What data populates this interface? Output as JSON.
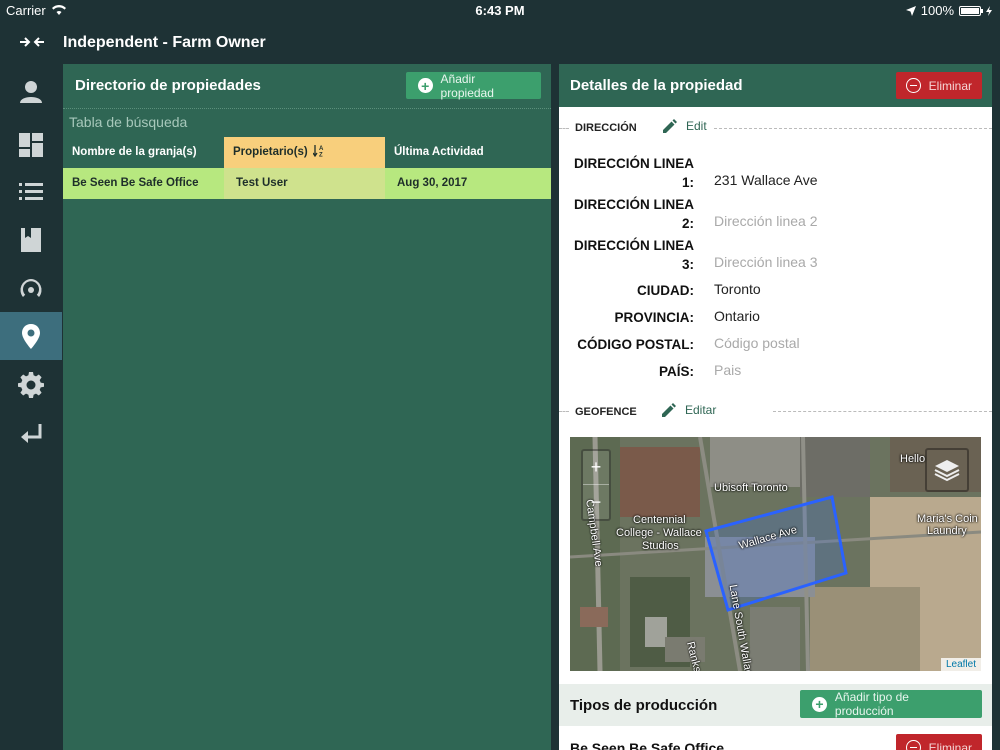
{
  "status_bar": {
    "carrier": "Carrier",
    "time": "6:43 PM",
    "battery": "100%"
  },
  "header": {
    "title": "Independent - Farm Owner"
  },
  "sidebar": {
    "items": [
      {
        "icon": "user-icon",
        "active": false
      },
      {
        "icon": "dashboard-icon",
        "active": false
      },
      {
        "icon": "list-icon",
        "active": false
      },
      {
        "icon": "book-icon",
        "active": false
      },
      {
        "icon": "broadcast-icon",
        "active": false
      },
      {
        "icon": "location-pin-icon",
        "active": true
      },
      {
        "icon": "gear-icon",
        "active": false
      },
      {
        "icon": "logout-arrow-icon",
        "active": false
      }
    ]
  },
  "directory": {
    "title": "Directorio de propiedades",
    "add_label": "Añadir propiedad",
    "search_label": "Tabla de búsqueda",
    "columns": [
      "Nombre de la granja(s)",
      "Propietario(s)",
      "Última Actividad"
    ],
    "rows": [
      {
        "farm": "Be Seen Be Safe Office",
        "owner": "Test User",
        "last_activity": "Aug 30, 2017"
      }
    ]
  },
  "details": {
    "title": "Detalles de la propiedad",
    "delete_label": "Eliminar",
    "address_section": "DIRECCIÓN",
    "address_edit": "Edit",
    "fields": {
      "line1_label_a": "DIRECCIÓN LINEA",
      "line1_label_b": "1:",
      "line1_value": "231 Wallace Ave",
      "line2_label_a": "DIRECCIÓN LINEA",
      "line2_label_b": "2:",
      "line2_placeholder": "Dirección linea 2",
      "line3_label_a": "DIRECCIÓN LINEA",
      "line3_label_b": "3:",
      "line3_placeholder": "Dirección linea 3",
      "city_label": "CIUDAD:",
      "city_value": "Toronto",
      "province_label": "PROVINCIA:",
      "province_value": "Ontario",
      "postal_label": "CÓDIGO POSTAL:",
      "postal_placeholder": "Código postal",
      "country_label": "PAÍS:",
      "country_placeholder": "Pais"
    },
    "geofence_section": "GEOFENCE",
    "geofence_edit": "Editar",
    "map": {
      "zoom_in": "+",
      "zoom_out": "−",
      "attribution": "Leaflet",
      "labels": [
        "Ubisoft Toronto",
        "Wallace Ave",
        "Centennial",
        "College - Wallace",
        "Studios",
        "Maria's Coin",
        "Laundry",
        "Campbell Ave",
        "Hello",
        "Lane South Wallace",
        "Ranks"
      ]
    },
    "production_title": "Tipos de producción",
    "add_production_label": "Añadir tipo de producción",
    "office_name": "Be Seen Be Safe Office",
    "office_delete_label": "Eliminar"
  },
  "colors": {
    "sidebar": "#1e3235",
    "panel_green": "#2f6654",
    "accent_green": "#3c9f6d",
    "danger": "#c0262b",
    "row_highlight": "#b7e87f",
    "sorted_column": "#f8cf7c",
    "active_nav": "#3d6e7d"
  }
}
